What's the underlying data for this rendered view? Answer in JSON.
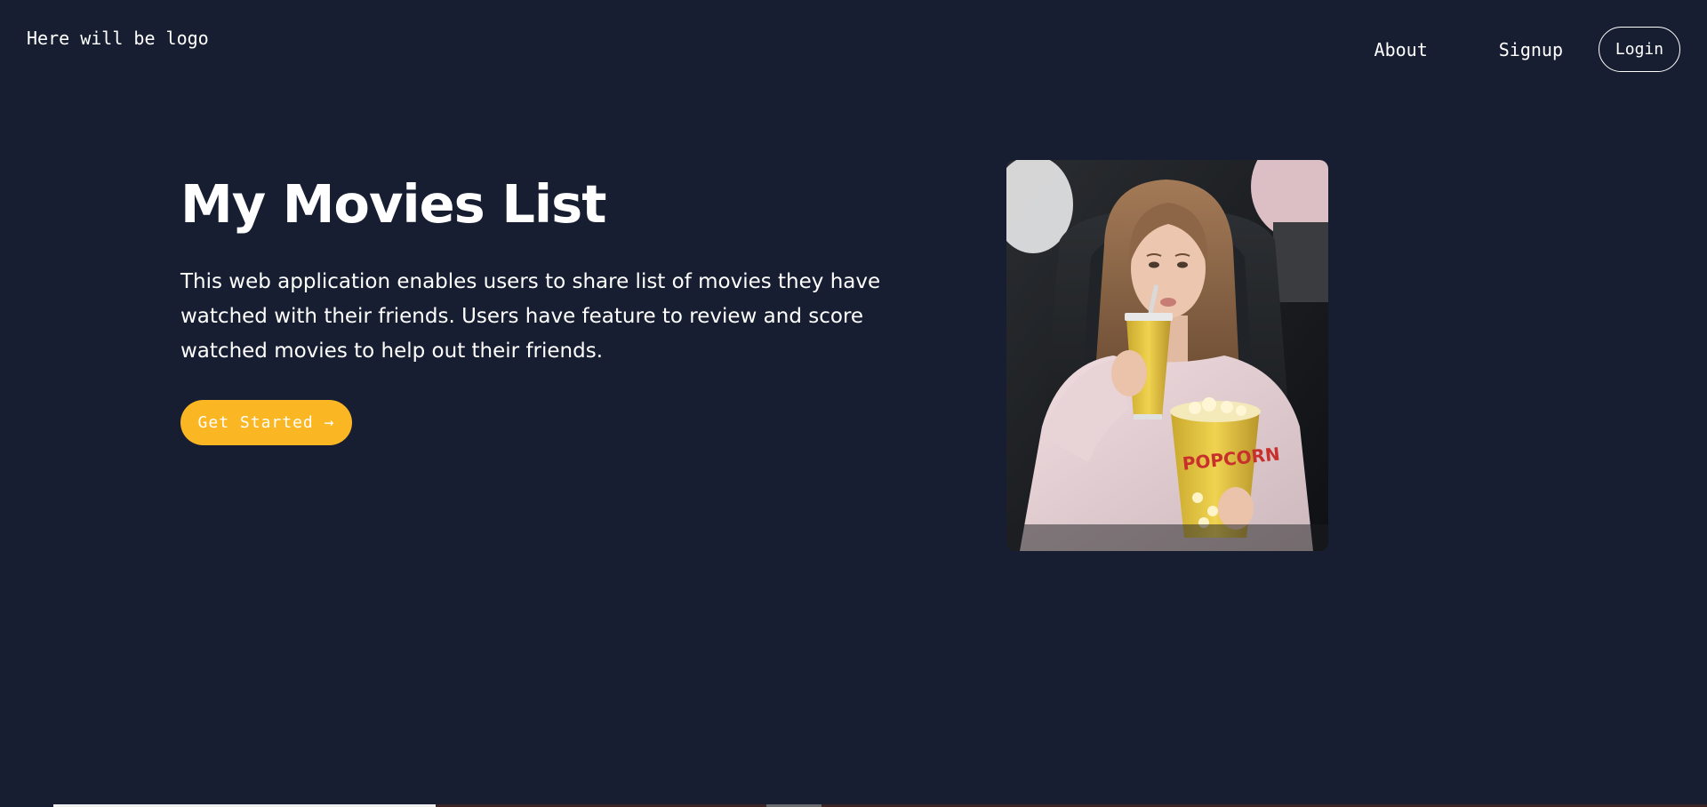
{
  "header": {
    "logo_text": "Here will be logo",
    "nav": {
      "about_label": "About",
      "signup_label": "Signup",
      "login_label": "Login"
    }
  },
  "hero": {
    "title": "My Movies List",
    "description": "This web application enables users to share list of movies they have watched with their friends. Users have feature to review and score watched movies to help out their friends.",
    "cta_label": "Get Started →",
    "image_alt": "Woman in a cinema seat drinking from a yellow cup and holding a popcorn bucket",
    "popcorn_text": "POPCORN"
  },
  "colors": {
    "background": "#171e31",
    "accent": "#fbb723",
    "text": "#ffffff"
  }
}
